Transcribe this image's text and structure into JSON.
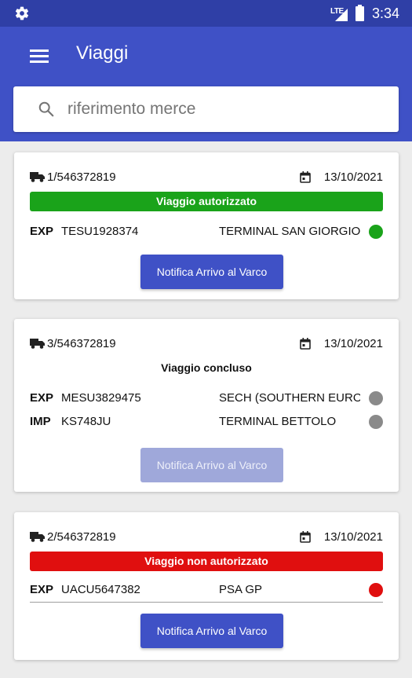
{
  "statusbar": {
    "network": "LTE",
    "time": "3:34",
    "settings_icon": "gear-icon"
  },
  "appbar": {
    "title": "Viaggi",
    "menu_icon": "hamburger-menu-icon"
  },
  "search": {
    "placeholder": "riferimento merce",
    "value": "",
    "icon": "search-icon"
  },
  "colors": {
    "primary": "#3f51c6",
    "status_bar": "#2f3fa6",
    "authorized": "#1aa31a",
    "rejected": "#e00f0f",
    "neutral_dot": "#8a8a8a",
    "button": "#3f51c6",
    "button_disabled": "#9fa8da"
  },
  "trips": [
    {
      "id": "1/546372819",
      "date": "13/10/2021",
      "status": "Viaggio autorizzato",
      "status_bg": "#1aa31a",
      "status_fg": "#ffffff",
      "containers": [
        {
          "direction": "EXP",
          "code": "TESU1928374",
          "terminal": "TERMINAL SAN GIORGIO",
          "dot_color": "#1aa31a"
        }
      ],
      "button_label": "Notifica Arrivo al Varco",
      "button_enabled": true
    },
    {
      "id": "3/546372819",
      "date": "13/10/2021",
      "status": "Viaggio concluso",
      "status_bg": "#ffffff",
      "status_fg": "#111111",
      "containers": [
        {
          "direction": "EXP",
          "code": "MESU3829475",
          "terminal": "SECH (SOUTHERN EUROP...",
          "dot_color": "#8a8a8a"
        },
        {
          "direction": "IMP",
          "code": "KS748JU",
          "terminal": "TERMINAL BETTOLO",
          "dot_color": "#8a8a8a"
        }
      ],
      "button_label": "Notifica Arrivo al Varco",
      "button_enabled": false
    },
    {
      "id": "2/546372819",
      "date": "13/10/2021",
      "status": "Viaggio non autorizzato",
      "status_bg": "#e00f0f",
      "status_fg": "#ffffff",
      "containers": [
        {
          "direction": "EXP",
          "code": "UACU5647382",
          "terminal": "PSA GP",
          "dot_color": "#e00f0f"
        }
      ],
      "button_label": "Notifica Arrivo al Varco",
      "button_enabled": true
    }
  ]
}
